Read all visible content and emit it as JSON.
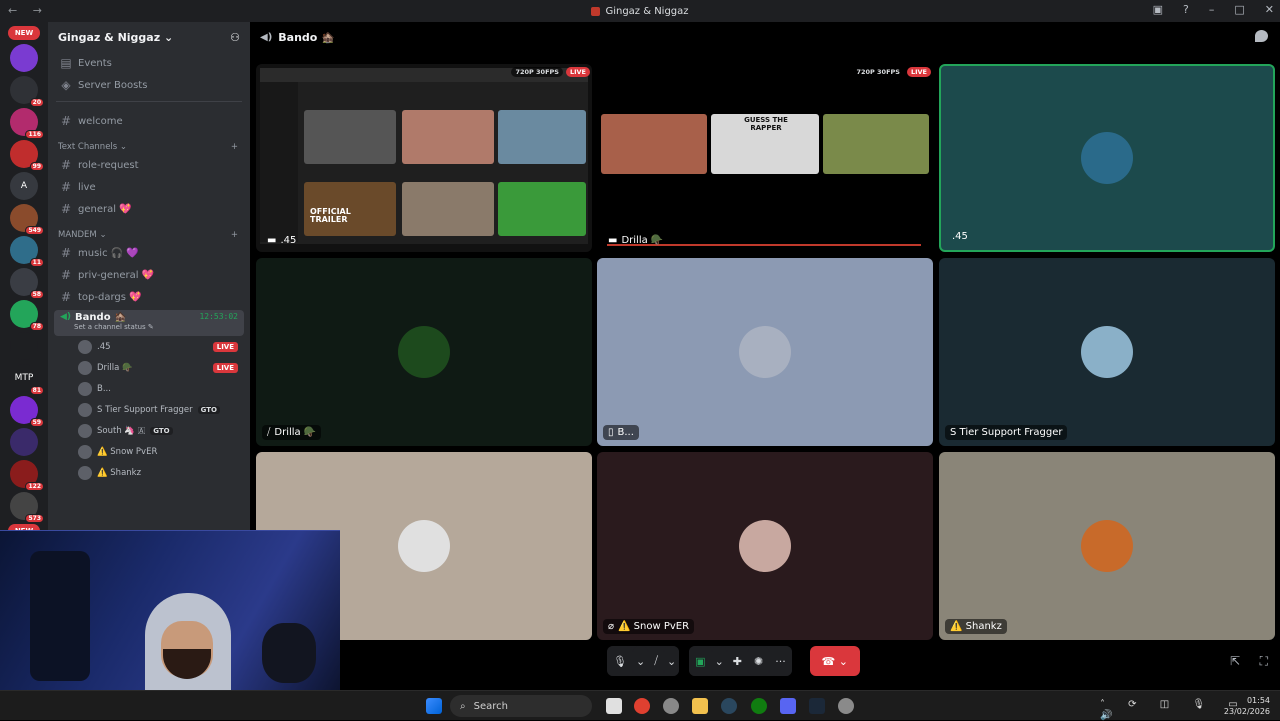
{
  "window": {
    "title": "Gingaz & Niggaz"
  },
  "guilds": {
    "new_label": "NEW",
    "items": [
      {
        "badge": "",
        "color": "#7a3bd1"
      },
      {
        "badge": "20",
        "color": "#2f3136"
      },
      {
        "badge": "116",
        "color": "#b22b6d"
      },
      {
        "badge": "99",
        "color": "#c02d2d"
      },
      {
        "badge": "",
        "color": "#36393f",
        "letter": "A"
      },
      {
        "badge": "549",
        "color": "#8a4b2c"
      },
      {
        "badge": "11",
        "color": "#2f6d8a"
      },
      {
        "badge": "58",
        "color": "#3a3d44"
      },
      {
        "badge": "78",
        "color": "#23a55a"
      },
      {
        "badge": "",
        "color": "#1e1f22"
      },
      {
        "badge": "81",
        "color": "#1e1f22",
        "letter": "MTP"
      },
      {
        "badge": "59",
        "color": "#7a2bd1"
      },
      {
        "badge": "",
        "color": "#3a2a6a"
      },
      {
        "badge": "122",
        "color": "#8a1c1c"
      },
      {
        "badge": "573",
        "color": "#444"
      }
    ],
    "new_label_bottom": "NEW"
  },
  "sidebar": {
    "server_name": "Gingaz & Niggaz",
    "top_items": [
      {
        "label": "Events",
        "icon": "calendar-icon"
      },
      {
        "label": "Server Boosts",
        "icon": "boost-icon"
      }
    ],
    "welcome": "welcome",
    "text_category": "Text Channels",
    "text_channels": [
      "role-request",
      "live",
      "general 💖"
    ],
    "mandem_category": "MANDEM",
    "mandem_channels": [
      "music 🎧 💜",
      "priv-general 💖",
      "top-dargs 💖"
    ],
    "voice_channel": {
      "name": "Bando 🏚️",
      "timer": "12:53:02",
      "status": "Set a channel status"
    },
    "voice_users": [
      {
        "name": ".45",
        "live": "LIVE",
        "tag": ""
      },
      {
        "name": "Drilla 🪖",
        "live": "LIVE",
        "tag": ""
      },
      {
        "name": "B...",
        "live": "",
        "tag": ""
      },
      {
        "name": "S Tier Support Fragger",
        "live": "",
        "tag": "GTO"
      },
      {
        "name": "South 🦄 🇦",
        "live": "",
        "tag": "GTO"
      },
      {
        "name": "⚠️ Snow PvER",
        "live": "",
        "tag": ""
      },
      {
        "name": "⚠️ Shankz",
        "live": "",
        "tag": ""
      }
    ]
  },
  "main": {
    "channel_title": "Bando 🏚️",
    "quality_badge": "720P 30FPS",
    "live_badge": "LIVE",
    "tiles": [
      {
        "name": ".45",
        "bg": "#111",
        "stream": true
      },
      {
        "name": "Drilla 🪖",
        "bg": "#000",
        "stream": true
      },
      {
        "name": ".45",
        "bg": "#1c4a4c"
      },
      {
        "name": "Drilla 🪖",
        "bg": "#0f1a14"
      },
      {
        "name": "B...",
        "bg": "#8c9ab3"
      },
      {
        "name": "S Tier Support Fragger",
        "bg": "#1a2a32"
      },
      {
        "name": "",
        "bg": "#b5a89a"
      },
      {
        "name": "⚠️ Snow PvER",
        "bg": "#2a1a1d"
      },
      {
        "name": "⚠️ Shankz",
        "bg": "#8a8578"
      }
    ],
    "stream_texts": {
      "trailer": "OFFICIAL TRAILER",
      "guess": "GUESS THE RAPPER"
    }
  },
  "taskbar": {
    "search": "Search",
    "time": "01:54",
    "date": "23/02/2026"
  }
}
